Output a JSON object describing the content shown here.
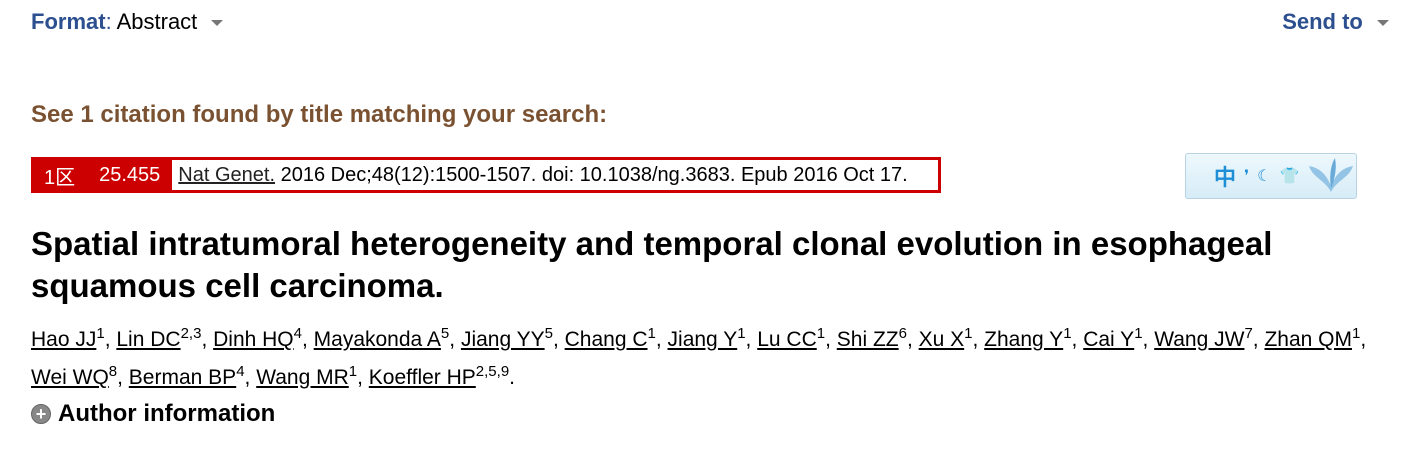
{
  "header": {
    "format_label": "Format",
    "format_value": "Abstract",
    "send_to": "Send to"
  },
  "search_notice": "See 1 citation found by title matching your search:",
  "citation": {
    "zone": "1区",
    "impact_factor": "25.455",
    "journal": "Nat Genet.",
    "details": "2016 Dec;48(12):1500-1507. doi: 10.1038/ng.3683. Epub 2016 Oct 17."
  },
  "translate_widget": {
    "char": "中",
    "icons": [
      "comma-icon",
      "moon-icon",
      "shirt-icon",
      "butterfly-icon"
    ]
  },
  "title": "Spatial intratumoral heterogeneity and temporal clonal evolution in esophageal squamous cell carcinoma.",
  "authors": [
    {
      "name": "Hao JJ",
      "sup": "1"
    },
    {
      "name": "Lin DC",
      "sup": "2,3"
    },
    {
      "name": "Dinh HQ",
      "sup": "4"
    },
    {
      "name": "Mayakonda A",
      "sup": "5"
    },
    {
      "name": "Jiang YY",
      "sup": "5"
    },
    {
      "name": "Chang C",
      "sup": "1"
    },
    {
      "name": "Jiang Y",
      "sup": "1"
    },
    {
      "name": "Lu CC",
      "sup": "1"
    },
    {
      "name": "Shi ZZ",
      "sup": "6"
    },
    {
      "name": "Xu X",
      "sup": "1"
    },
    {
      "name": "Zhang Y",
      "sup": "1"
    },
    {
      "name": "Cai Y",
      "sup": "1"
    },
    {
      "name": "Wang JW",
      "sup": "7"
    },
    {
      "name": "Zhan QM",
      "sup": "1"
    },
    {
      "name": "Wei WQ",
      "sup": "8"
    },
    {
      "name": "Berman BP",
      "sup": "4"
    },
    {
      "name": "Wang MR",
      "sup": "1"
    },
    {
      "name": "Koeffler HP",
      "sup": "2,5,9"
    }
  ],
  "author_info_label": "Author information",
  "colors": {
    "link_blue": "#2c4f8f",
    "notice_brown": "#7b5231",
    "badge_red": "#cc0000"
  }
}
